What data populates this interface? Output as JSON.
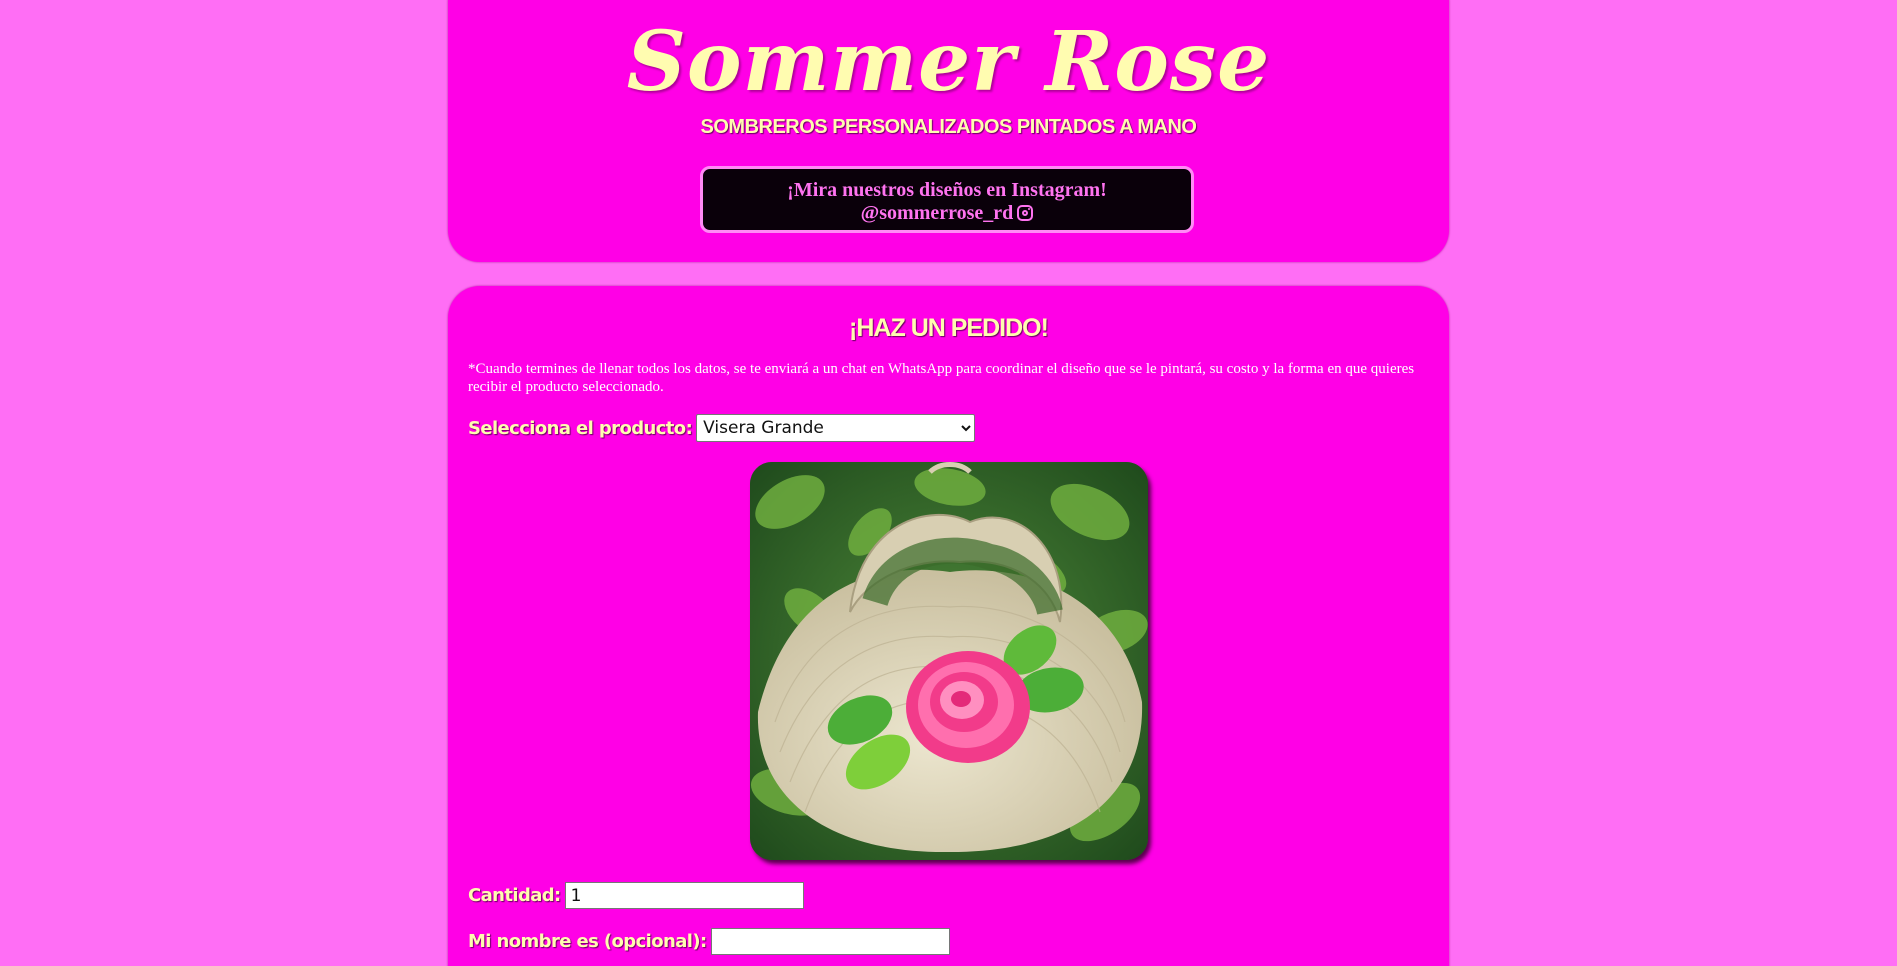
{
  "header": {
    "brand": "Sommer Rose",
    "tagline": "Sombreros personalizados pintados a mano",
    "instagram": {
      "line1": "¡Mira nuestros diseños en Instagram!",
      "line2": "@sommerrose_rd",
      "icon": "instagram-icon"
    }
  },
  "order": {
    "title": "¡Haz un pedido!",
    "note": "*Cuando termines de llenar todos los datos, se te enviará a un chat en WhatsApp para coordinar el diseño que se le pintará, su costo y la forma en que quieres recibir el producto seleccionado.",
    "product_label": "Selecciona el producto:",
    "product_selected": "Visera Grande",
    "quantity_label": "Cantidad:",
    "quantity_value": "1",
    "name_label": "Mi nombre es (opcional):",
    "name_value": ""
  },
  "colors": {
    "page_background": "#ff6ef5",
    "card_background": "#ff00e6",
    "heading_text": "#fffcb0",
    "instagram_box": "#0a000a",
    "instagram_text": "#ff73f0"
  }
}
